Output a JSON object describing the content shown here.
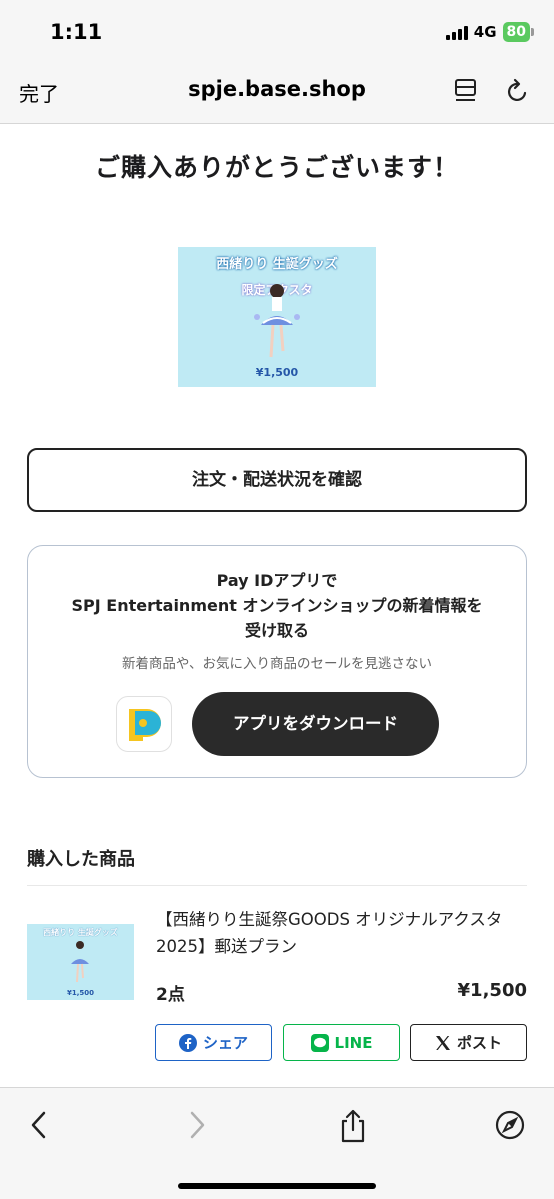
{
  "status_bar": {
    "time": "1:11",
    "network": "4G",
    "battery": "80"
  },
  "browser": {
    "done_label": "完了",
    "url": "spje.base.shop"
  },
  "page": {
    "title": "ご購入ありがとうございます！",
    "hero_image": {
      "caption_top": "西緒りり 生誕グッズ",
      "caption_sub": "限定アクスタ",
      "price": "¥1,500"
    },
    "order_status_button": "注文・配送状況を確認"
  },
  "payid": {
    "title_line1": "Pay IDアプリで",
    "title_line2": "SPJ Entertainment オンラインショップの新着情報を",
    "title_line3": "受け取る",
    "description": "新着商品や、お気に入り商品のセールを見逃さない",
    "download_button": "アプリをダウンロード"
  },
  "purchased": {
    "section_title": "購入した商品",
    "items": [
      {
        "name_line1": "【西緒りり生誕祭GOODS オリジナルアクスタ",
        "name_line2": "2025】郵送プラン",
        "quantity": "2点",
        "price": "¥1,500",
        "thumb_caption": "西緒りり 生誕グッズ",
        "thumb_price": "¥1,500"
      }
    ],
    "share": {
      "facebook": "シェア",
      "line": "LINE",
      "x": "ポスト"
    }
  },
  "colors": {
    "facebook": "#1e63c6",
    "line": "#06b44a",
    "battery": "#5ac95f",
    "image_bg": "#bfeaf4"
  }
}
